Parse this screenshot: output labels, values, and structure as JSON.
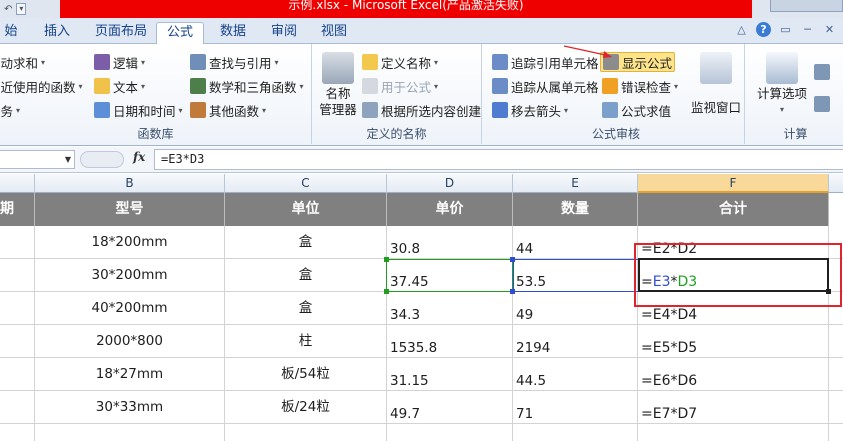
{
  "title": "示例.xlsx - Microsoft Excel(产品激活失败)",
  "tabs": [
    "始",
    "插入",
    "页面布局",
    "公式",
    "数据",
    "审阅",
    "视图"
  ],
  "active_tab": "公式",
  "ribbon": {
    "func_lib": {
      "label": "函数库",
      "items": [
        "自动求和",
        "最近使用的函数",
        "财务",
        "逻辑",
        "文本",
        "日期和时间",
        "查找与引用",
        "数学和三角函数",
        "其他函数"
      ]
    },
    "names": {
      "label": "定义的名称",
      "manager_line1": "名称",
      "manager_line2": "管理器",
      "items": [
        "定义名称",
        "用于公式",
        "根据所选内容创建"
      ]
    },
    "audit": {
      "label": "公式审核",
      "items": [
        "追踪引用单元格",
        "追踪从属单元格",
        "移去箭头",
        "显示公式",
        "错误检查",
        "公式求值"
      ],
      "watch": "监视窗口"
    },
    "calc": {
      "label": "计算",
      "options": "计算选项"
    }
  },
  "formula_bar": {
    "name_box": "",
    "fx": "fx",
    "formula": "=E3*D3"
  },
  "columns": [
    "B",
    "C",
    "D",
    "E",
    "F"
  ],
  "selected_column": "F",
  "header": [
    "期",
    "型号",
    "单位",
    "单价",
    "数量",
    "合计"
  ],
  "rows": [
    {
      "model": "18*200mm",
      "unit": "盒",
      "price": "30.8",
      "qty": "44",
      "total": "=E2*D2"
    },
    {
      "model": "30*200mm",
      "unit": "盒",
      "price": "37.45",
      "qty": "53.5",
      "total": "=E3*D3"
    },
    {
      "model": "40*200mm",
      "unit": "盒",
      "price": "34.3",
      "qty": "49",
      "total": "=E4*D4"
    },
    {
      "model": "2000*800",
      "unit": "柱",
      "price": "1535.8",
      "qty": "2194",
      "total": "=E5*D5"
    },
    {
      "model": "18*27mm",
      "unit": "板/54粒",
      "price": "31.15",
      "qty": "44.5",
      "total": "=E6*D6"
    },
    {
      "model": "30*33mm",
      "unit": "板/24粒",
      "price": "49.7",
      "qty": "71",
      "total": "=E7*D7"
    }
  ],
  "active_formula_parts": {
    "eq": "=",
    "ref1": "E3",
    "op": "*",
    "ref2": "D3"
  },
  "colors": {
    "ref1": "#2f4dd0",
    "ref2": "#1f9e1f",
    "red_box": "#e0242b",
    "header_bg": "#808080"
  }
}
